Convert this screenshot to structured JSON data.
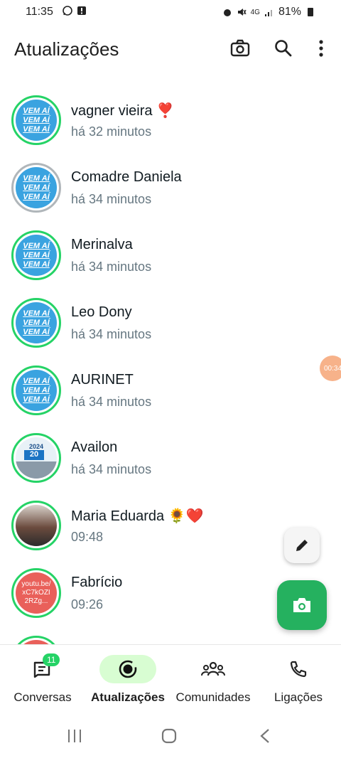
{
  "status": {
    "time": "11:35",
    "battery": "81%",
    "network": "4G"
  },
  "header": {
    "title": "Atualizações",
    "icons": [
      "camera-icon",
      "search-icon",
      "more-vert-icon"
    ]
  },
  "avatar_texts": {
    "vemai": [
      "VEM AÍ",
      "VEM AÍ",
      "VEM AÍ"
    ],
    "availon_year": "2024",
    "availon_num": "20",
    "fabricio_link": [
      "youtu.be/",
      "xC7kOZI",
      "2RZg..."
    ]
  },
  "updates": [
    {
      "name": "vagner vieira ❣️",
      "time": "há 32 minutos",
      "seen": false
    },
    {
      "name": "Comadre Daniela",
      "time": "há 34 minutos",
      "seen": true
    },
    {
      "name": "Merinalva",
      "time": "há 34 minutos",
      "seen": false
    },
    {
      "name": "Leo Dony",
      "time": "há 34 minutos",
      "seen": false
    },
    {
      "name": "AURINET",
      "time": "há 34 minutos",
      "seen": false
    },
    {
      "name": "Availon",
      "time": "há 34 minutos",
      "seen": false
    },
    {
      "name": "Maria Eduarda 🌻❤️",
      "time": "09:48",
      "seen": false
    },
    {
      "name": "Fabrício",
      "time": "09:26",
      "seen": false
    }
  ],
  "timer_badge": "00:34",
  "nav": {
    "conversas": {
      "label": "Conversas",
      "badge": "11"
    },
    "atualizacoes": {
      "label": "Atualizações"
    },
    "comunidades": {
      "label": "Comunidades"
    },
    "ligacoes": {
      "label": "Ligações"
    }
  },
  "colors": {
    "accent": "#25d366",
    "fab": "#25b15f",
    "active_pill": "#d8fdd2"
  }
}
